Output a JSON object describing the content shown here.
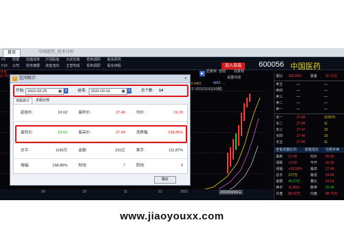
{
  "window_tabs": [
    "首页",
    "中国医药_技术分析"
  ],
  "menu_row1": [
    "F9",
    "研报",
    "估值清单",
    "沪深股指",
    "大宗交易",
    "机构调研",
    "股东研究"
  ],
  "menu_row2": [
    "F10",
    "公司",
    "财务摘要",
    "资金流向",
    "主营构成",
    "机构调研",
    "股东持股"
  ],
  "left_labels": [
    "分析",
    "(0.76)"
  ],
  "chart_header": {
    "price_label": "最高: 19.4481",
    "ma_label": "MA2: ...",
    "settings_link": "设置均线",
    "date_range": "2021/8/2~2022/3/16[150根]"
  },
  "toolbar_buttons": [
    "后复权",
    "自动",
    "前复权",
    "复权提示"
  ],
  "stock": {
    "add_button": "加入自选",
    "code": "600056",
    "name": "中国医药"
  },
  "right_panel": {
    "top": [
      {
        "label": "委比",
        "value": "100.00%",
        "label2": "委差",
        "value2": "11.71万"
      }
    ],
    "sell": [
      {
        "label": "卖五",
        "price": "—",
        "vol": "—"
      },
      {
        "label": "卖四",
        "price": "—",
        "vol": "—"
      },
      {
        "label": "卖三",
        "price": "—",
        "vol": "—"
      },
      {
        "label": "卖二",
        "price": "—",
        "vol": "—"
      },
      {
        "label": "卖一",
        "price": "—",
        "vol": "—"
      }
    ],
    "buy": [
      {
        "label": "买一",
        "price": "27.49",
        "vol": "116570"
      },
      {
        "label": "买二",
        "price": "27.48",
        "vol": "11"
      },
      {
        "label": "买三",
        "price": "27.47",
        "vol": "15"
      },
      {
        "label": "买四",
        "price": "27.46",
        "vol": "10"
      },
      {
        "label": "买五",
        "price": "27.45",
        "vol": "11"
      }
    ],
    "menu": [
      "查看完整队列",
      "逐笔成交",
      "付费手续"
    ],
    "stats": [
      {
        "k1": "最新",
        "v1": "27.49",
        "k2": "均价",
        "v2": "26.90"
      },
      {
        "k1": "涨跌",
        "v1": "+2.50",
        "k2": "今开",
        "v2": "26.26"
      },
      {
        "k1": "涨幅",
        "v1": "+10.00%",
        "k2": "最高",
        "v2": "27.49"
      },
      {
        "k1": "总手",
        "v1": "177万",
        "k2": "最低",
        "v2": "24.68"
      },
      {
        "k1": "金额",
        "v1": "46.57亿",
        "k2": "量比",
        "v2": "24.53"
      },
      {
        "k1": "换手",
        "v1": "11.85%",
        "k2": "跌停",
        "v2": "22.49"
      },
      {
        "k1": "外盘",
        "v1": "88.92万",
        "k2": "内盘",
        "v2": "88.72万"
      }
    ]
  },
  "date_axis": [
    "09",
    "10",
    "11",
    "12",
    "2022",
    "2022/03/16/三"
  ],
  "dialog": {
    "title": "区间统计",
    "close": "×",
    "start_label": "开始:",
    "start_date": "2022-02-25",
    "end_label": "结束:",
    "end_date": "2022-03-16",
    "total_label": "总个数:",
    "total_value": "14",
    "tabs": [
      "单股统计",
      "多股比较"
    ],
    "rows": [
      {
        "k1": "起始价:",
        "v1": "10.62",
        "k2": "最终价:",
        "v2": "27.49",
        "k3": "均价:",
        "v3": "19.29"
      },
      {
        "k1": "最低价:",
        "v1": "10.62",
        "k2": "最高价:",
        "v2": "27.49",
        "k3": "涨跌幅:",
        "v3": "158.85%"
      },
      {
        "k1": "总手:",
        "v1": "1195万",
        "k2": "金额:",
        "v2": "231亿",
        "k3": "换手:",
        "v3": "111.87%"
      },
      {
        "k1": "振幅:",
        "v1": "158.85%",
        "k2": "阳线:",
        "v2": "7",
        "k3": "阴线:",
        "v3": "2"
      }
    ],
    "ok_button": "确定"
  },
  "colors": {
    "up": "#ff3b3b",
    "down": "#2bd12b",
    "highlight": "#e01515",
    "title_yellow": "#e8d21a"
  },
  "watermark": "www.jiaoyouxx.com"
}
